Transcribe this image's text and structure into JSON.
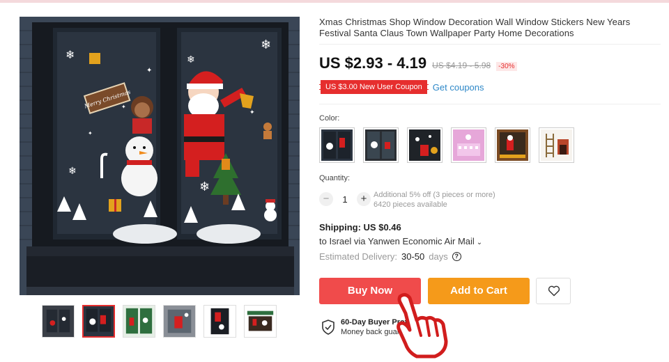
{
  "product": {
    "title": "Xmas Christmas Shop Window Decoration Wall Window Stickers New Years Festival Santa Claus Town Wallpaper Party Home Decorations",
    "price": "US $2.93 - 4.19",
    "old_price": "US $4.19 - 5.98",
    "discount": "-30%",
    "coupon": "US $3.00 New User Coupon",
    "get_coupons": "Get coupons"
  },
  "image_text": {
    "sign": "Merry Christmas"
  },
  "colors": {
    "label": "Color:",
    "accent": "#e62e2e",
    "buy_now": "#f04b4b",
    "add_to_cart": "#f59a1a",
    "link": "#2e88c8"
  },
  "quantity": {
    "label": "Quantity:",
    "minus": "−",
    "value": "1",
    "plus": "+",
    "discount_note": "Additional 5% off (3 pieces or more)",
    "available": "6420 pieces available"
  },
  "shipping": {
    "title": "Shipping: US $0.46",
    "via": "to Israel via Yanwen Economic Air Mail",
    "chevron": "⌄",
    "delivery_label": "Estimated Delivery:",
    "delivery_days": "30-50",
    "days_word": "days",
    "help": "?"
  },
  "actions": {
    "buy_now": "Buy Now",
    "add_to_cart": "Add to Cart"
  },
  "protection": {
    "title": "60-Day Buyer Protection",
    "subtitle": "Money back guarantee"
  },
  "icons": [
    "heart-icon",
    "shield-check-icon",
    "pointing-hand-icon",
    "question-icon",
    "chevron-down-icon"
  ]
}
